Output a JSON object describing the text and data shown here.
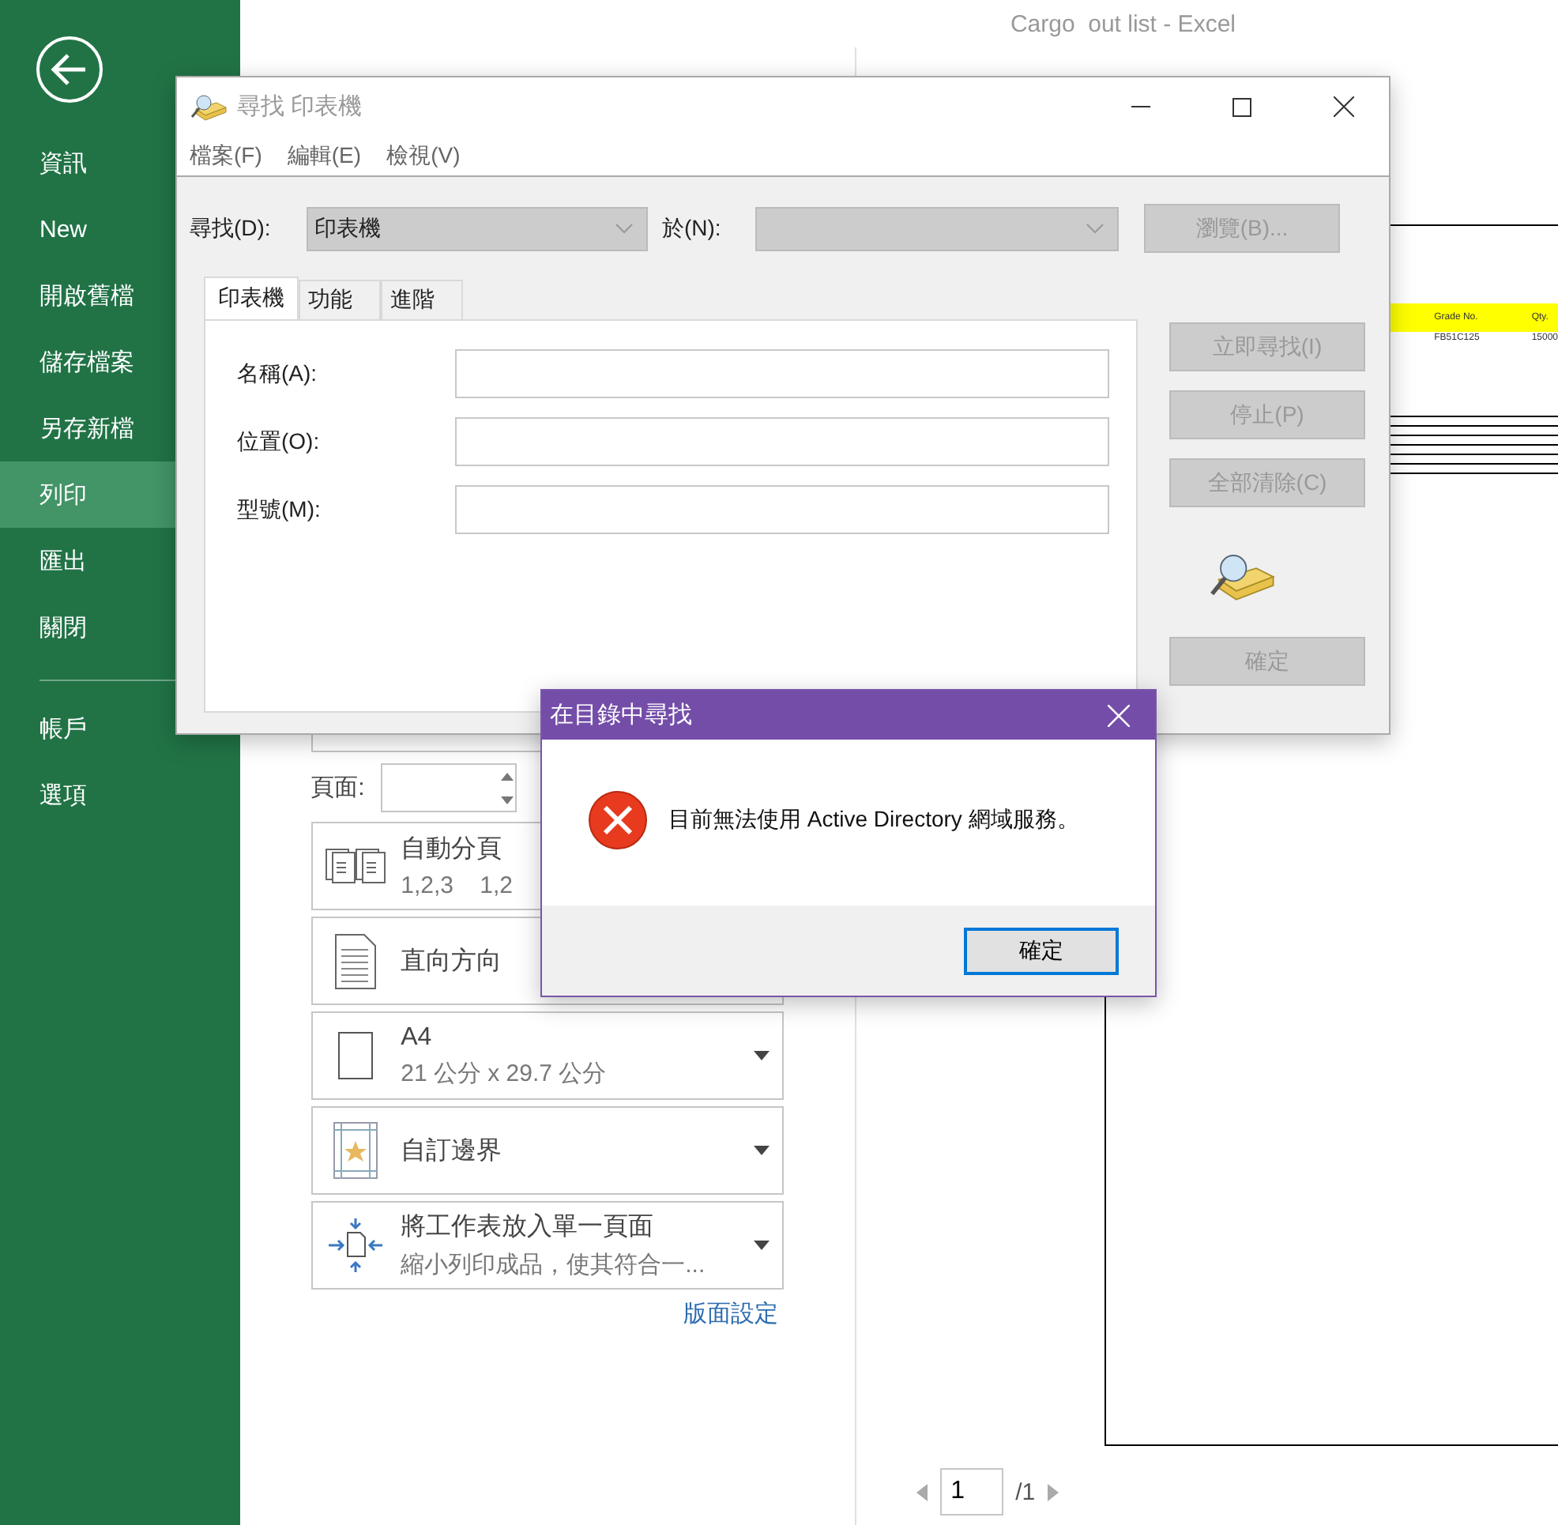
{
  "app": {
    "title": "Cargo  out list - Excel"
  },
  "sidebar": {
    "items": [
      {
        "label": "資訊",
        "selected": false
      },
      {
        "label": "New",
        "selected": false
      },
      {
        "label": "開啟舊檔",
        "selected": false
      },
      {
        "label": "儲存檔案",
        "selected": false
      },
      {
        "label": "另存新檔",
        "selected": false
      },
      {
        "label": "列印",
        "selected": true
      },
      {
        "label": "匯出",
        "selected": false
      },
      {
        "label": "關閉",
        "selected": false
      }
    ],
    "bottom_items": [
      {
        "label": "帳戶",
        "selected": false
      },
      {
        "label": "選項",
        "selected": false
      }
    ]
  },
  "print_settings": {
    "pages_label": "頁面:",
    "cards": [
      {
        "kind": "collate",
        "title": "自動分頁",
        "subtitle": "1,2,3    1,2"
      },
      {
        "kind": "orientation",
        "title": "直向方向"
      },
      {
        "kind": "paper",
        "title": "A4",
        "subtitle": "21 公分 x 29.7 公分",
        "dropdown": true
      },
      {
        "kind": "margins",
        "title": "自訂邊界",
        "dropdown": true
      },
      {
        "kind": "scaling",
        "title": "將工作表放入單一頁面",
        "subtitle": "縮小列印成品，使其符合一...",
        "dropdown": true
      }
    ],
    "link": "版面設定"
  },
  "preview": {
    "header": [
      "Grade No.",
      "Qty."
    ],
    "row": [
      "FB51C125",
      "15000"
    ],
    "page_nav": {
      "current": "1",
      "total": "/1"
    }
  },
  "find_dialog": {
    "title": "尋找 印表機",
    "menu": [
      "檔案(F)",
      "編輯(E)",
      "檢視(V)"
    ],
    "find_label": "尋找(D):",
    "find_value": "印表機",
    "in_label": "於(N):",
    "browse": {
      "label": "瀏覽(B)...",
      "disabled": true
    },
    "tabs": [
      {
        "label": "印表機",
        "selected": true
      },
      {
        "label": "功能",
        "selected": false
      },
      {
        "label": "進階",
        "selected": false
      }
    ],
    "fields": [
      {
        "label": "名稱(A):"
      },
      {
        "label": "位置(O):"
      },
      {
        "label": "型號(M):"
      }
    ],
    "actions": [
      {
        "label": "立即尋找(I)",
        "disabled": true
      },
      {
        "label": "停止(P)",
        "disabled": true
      },
      {
        "label": "全部清除(C)",
        "disabled": true
      }
    ],
    "ok": {
      "label": "確定",
      "disabled": true
    }
  },
  "error_dialog": {
    "title": "在目錄中尋找",
    "message": "目前無法使用 Active Directory 網域服務。",
    "button": {
      "label": "確定",
      "focused": true
    }
  }
}
